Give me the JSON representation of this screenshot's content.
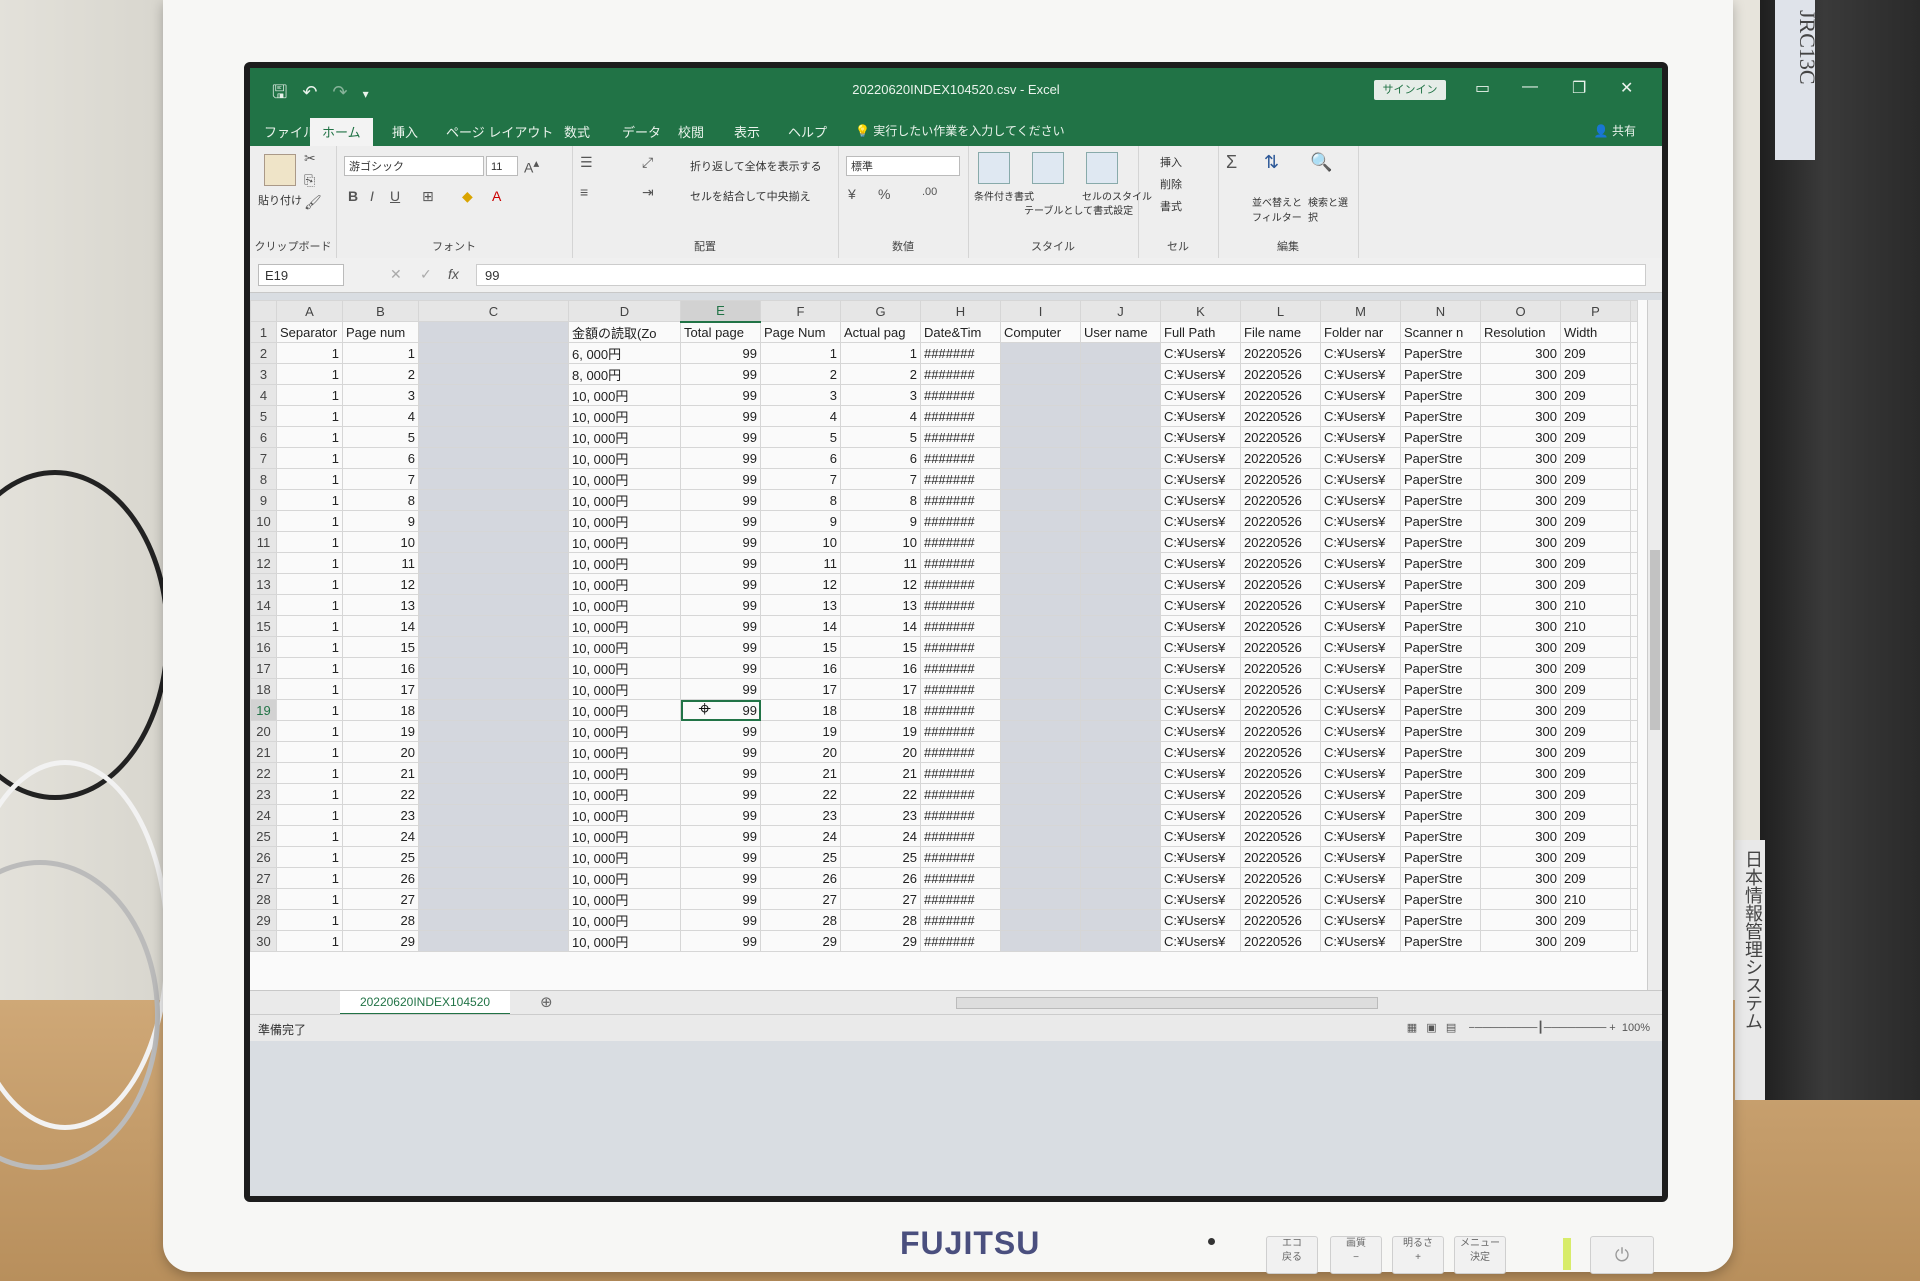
{
  "photo": {
    "monitor_brand": "FUJITSU",
    "monitor_buttons": [
      {
        "top": "エコ",
        "bottom": "戻る"
      },
      {
        "top": "画質",
        "bottom": "−"
      },
      {
        "top": "明るさ",
        "bottom": "+"
      },
      {
        "top": "メニュー",
        "bottom": "決定"
      }
    ],
    "tower_label": "JRC13C",
    "tower_side_label": "日本情報管理システム"
  },
  "excel": {
    "window_title": "20220620INDEX104520.csv  -  Excel",
    "signin_label": "サインイン",
    "menu_tabs": [
      "ファイル",
      "ホーム",
      "挿入",
      "ページ レイアウト",
      "数式",
      "データ",
      "校閲",
      "表示",
      "ヘルプ"
    ],
    "active_tab": "ホーム",
    "tell_me": "実行したい作業を入力してください",
    "share": "共有",
    "ribbon": {
      "clipboard": {
        "paste": "貼り付け",
        "label": "クリップボード"
      },
      "font": {
        "name": "游ゴシック",
        "size": "11",
        "label": "フォント"
      },
      "alignment": {
        "wrap": "折り返して全体を表示する",
        "merge": "セルを結合して中央揃え",
        "label": "配置"
      },
      "number": {
        "format": "標準",
        "label": "数値"
      },
      "styles": {
        "conditional": "条件付き書式",
        "table": "テーブルとして書式設定",
        "cell": "セルのスタイル",
        "label": "スタイル"
      },
      "cells": {
        "insert": "挿入",
        "delete": "削除",
        "format": "書式",
        "label": "セル"
      },
      "editing": {
        "sort": "並べ替えとフィルター",
        "find": "検索と選択",
        "label": "編集"
      }
    },
    "name_box": "E19",
    "formula_value": "99",
    "columns": [
      "A",
      "B",
      "C",
      "D",
      "E",
      "F",
      "G",
      "H",
      "I",
      "J",
      "K",
      "L",
      "M",
      "N",
      "O",
      "P"
    ],
    "selected_column": "E",
    "header_row": [
      "Separator",
      "Page num",
      "",
      "金額の読取(Zo",
      "Total page",
      "Page Num",
      "Actual pag",
      "Date&Tim",
      "Computer",
      "User name",
      "Full Path",
      "File name",
      "Folder nar",
      "Scanner n",
      "Resolution",
      "Width"
    ],
    "rows": [
      {
        "r": "2",
        "b": "1",
        "d": "6, 000円",
        "f": "1",
        "g": "1",
        "p": "209"
      },
      {
        "r": "3",
        "b": "2",
        "d": "8,  000円",
        "f": "2",
        "g": "2",
        "p": "209"
      },
      {
        "r": "4",
        "b": "3",
        "d": "10, 000円",
        "f": "3",
        "g": "3",
        "p": "209"
      },
      {
        "r": "5",
        "b": "4",
        "d": "10, 000円",
        "f": "4",
        "g": "4",
        "p": "209"
      },
      {
        "r": "6",
        "b": "5",
        "d": "10, 000円",
        "f": "5",
        "g": "5",
        "p": "209"
      },
      {
        "r": "7",
        "b": "6",
        "d": "10, 000円",
        "f": "6",
        "g": "6",
        "p": "209"
      },
      {
        "r": "8",
        "b": "7",
        "d": "10, 000円",
        "f": "7",
        "g": "7",
        "p": "209"
      },
      {
        "r": "9",
        "b": "8",
        "d": "10, 000円",
        "f": "8",
        "g": "8",
        "p": "209"
      },
      {
        "r": "10",
        "b": "9",
        "d": "10, 000円",
        "f": "9",
        "g": "9",
        "p": "209"
      },
      {
        "r": "11",
        "b": "10",
        "d": "10, 000円",
        "f": "10",
        "g": "10",
        "p": "209"
      },
      {
        "r": "12",
        "b": "11",
        "d": "10, 000円",
        "f": "11",
        "g": "11",
        "p": "209"
      },
      {
        "r": "13",
        "b": "12",
        "d": "10, 000円",
        "f": "12",
        "g": "12",
        "p": "209"
      },
      {
        "r": "14",
        "b": "13",
        "d": "10, 000円",
        "f": "13",
        "g": "13",
        "p": "210"
      },
      {
        "r": "15",
        "b": "14",
        "d": "10, 000円",
        "f": "14",
        "g": "14",
        "p": "210"
      },
      {
        "r": "16",
        "b": "15",
        "d": "10, 000円",
        "f": "15",
        "g": "15",
        "p": "209"
      },
      {
        "r": "17",
        "b": "16",
        "d": "10, 000円",
        "f": "16",
        "g": "16",
        "p": "209"
      },
      {
        "r": "18",
        "b": "17",
        "d": "10, 000円",
        "f": "17",
        "g": "17",
        "p": "209"
      },
      {
        "r": "19",
        "b": "18",
        "d": "10, 000円",
        "f": "18",
        "g": "18",
        "p": "209"
      },
      {
        "r": "20",
        "b": "19",
        "d": "10, 000円",
        "f": "19",
        "g": "19",
        "p": "209"
      },
      {
        "r": "21",
        "b": "20",
        "d": "10, 000円",
        "f": "20",
        "g": "20",
        "p": "209"
      },
      {
        "r": "22",
        "b": "21",
        "d": "10, 000円",
        "f": "21",
        "g": "21",
        "p": "209"
      },
      {
        "r": "23",
        "b": "22",
        "d": "10, 000円",
        "f": "22",
        "g": "22",
        "p": "209"
      },
      {
        "r": "24",
        "b": "23",
        "d": "10, 000円",
        "f": "23",
        "g": "23",
        "p": "209"
      },
      {
        "r": "25",
        "b": "24",
        "d": "10, 000円",
        "f": "24",
        "g": "24",
        "p": "209"
      },
      {
        "r": "26",
        "b": "25",
        "d": "10, 000円",
        "f": "25",
        "g": "25",
        "p": "209"
      },
      {
        "r": "27",
        "b": "26",
        "d": "10, 000円",
        "f": "26",
        "g": "26",
        "p": "209"
      },
      {
        "r": "28",
        "b": "27",
        "d": "10, 000円",
        "f": "27",
        "g": "27",
        "p": "210"
      },
      {
        "r": "29",
        "b": "28",
        "d": "10, 000円",
        "f": "28",
        "g": "28",
        "p": "209"
      },
      {
        "r": "30",
        "b": "29",
        "d": "10, 000円",
        "f": "29",
        "g": "29",
        "p": "209"
      }
    ],
    "constant_cells": {
      "a": "1",
      "e": "99",
      "h": "#######",
      "k": "C:¥Users¥",
      "l": "20220526",
      "m": "C:¥Users¥",
      "n": "PaperStre",
      "o": "300"
    },
    "active_cell": "E19",
    "sheet_tab": "20220620INDEX104520",
    "status": "準備完了",
    "zoom": "100%",
    "colors": {
      "excel_green": "#217346",
      "selection_border": "#217346"
    }
  }
}
